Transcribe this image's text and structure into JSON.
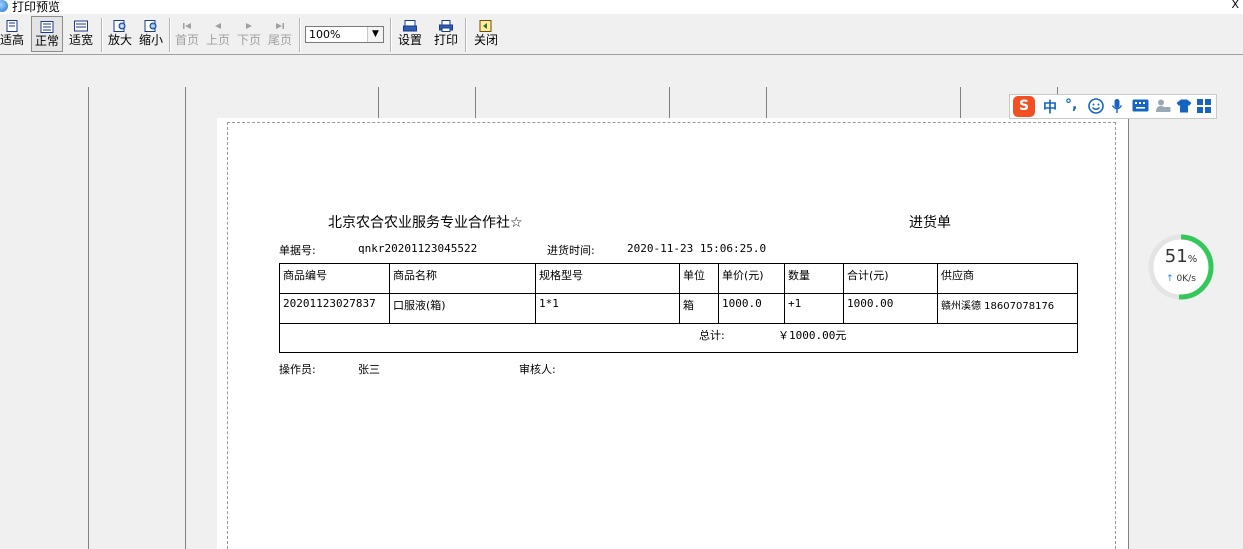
{
  "window": {
    "title": "打印预览",
    "close_glyph": "X"
  },
  "toolbar": {
    "fit_height": "适高",
    "normal": "正常",
    "fit_width": "适宽",
    "zoom_in": "放大",
    "zoom_out": "缩小",
    "first_page": "首页",
    "prev_page": "上页",
    "next_page": "下页",
    "last_page": "尾页",
    "zoom_value": "100%",
    "settings": "设置",
    "print": "打印",
    "close": "关闭"
  },
  "document": {
    "company": "北京农合农业服务专业合作社☆",
    "doc_type": "进货单",
    "doc_no_label": "单据号:",
    "doc_no": "qnkr20201123045522",
    "time_label": "进货时间:",
    "time": "2020-11-23 15:06:25.0",
    "table": {
      "headers": [
        "商品编号",
        "商品名称",
        "规格型号",
        "单位",
        "单价(元)",
        "数量",
        "合计(元)",
        "供应商"
      ],
      "rows": [
        [
          "20201123027837",
          "口服液(箱)",
          "1*1",
          "箱",
          "1000.0",
          "+1",
          "1000.00",
          "赣州溪德 18607078176"
        ]
      ],
      "total_label": "总计:",
      "total_value": "￥1000.00元"
    },
    "operator_label": "操作员:",
    "operator": "张三",
    "reviewer_label": "审核人:"
  },
  "ime": {
    "logo": "S",
    "lang": "中",
    "punct": "°,"
  },
  "net_widget": {
    "percent": "51",
    "percent_unit": "%",
    "speed": "0K/s",
    "speed_arrow": "↑",
    "level": 0.51
  }
}
